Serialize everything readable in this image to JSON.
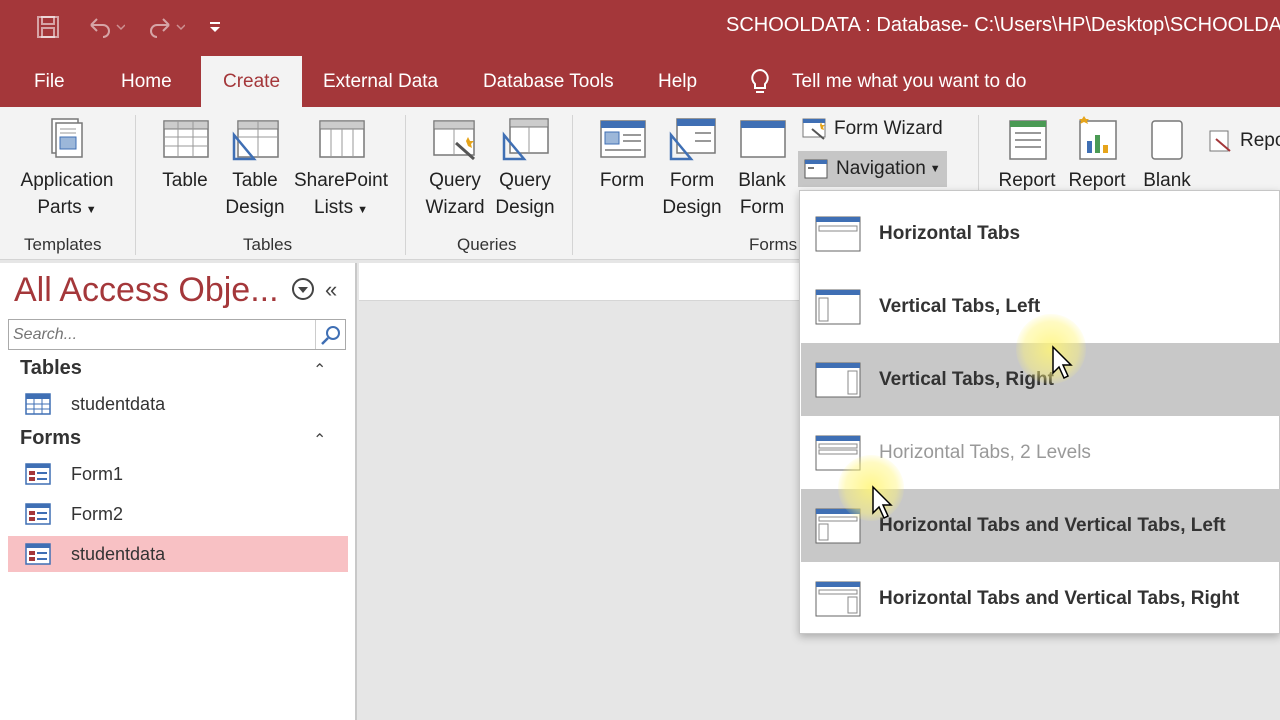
{
  "title_bar": {
    "title": "SCHOOLDATA : Database- C:\\Users\\HP\\Desktop\\SCHOOLDATA",
    "qat": [
      "save-icon",
      "undo-icon",
      "redo-icon",
      "customize-icon"
    ]
  },
  "tabs": [
    {
      "label": "File"
    },
    {
      "label": "Home"
    },
    {
      "label": "Create",
      "active": true
    },
    {
      "label": "External Data"
    },
    {
      "label": "Database Tools"
    },
    {
      "label": "Help"
    }
  ],
  "tell_me": "Tell me what you want to do",
  "ribbon": {
    "templates": {
      "app_parts": "Application",
      "app_parts_2": "Parts",
      "group": "Templates"
    },
    "tables": {
      "table": "Table",
      "table_design_1": "Table",
      "table_design_2": "Design",
      "sharepoint_1": "SharePoint",
      "sharepoint_2": "Lists",
      "group": "Tables"
    },
    "queries": {
      "wizard_1": "Query",
      "wizard_2": "Wizard",
      "design_1": "Query",
      "design_2": "Design",
      "group": "Queries"
    },
    "forms": {
      "form": "Form",
      "form_design_1": "Form",
      "form_design_2": "Design",
      "blank_1": "Blank",
      "blank_2": "Form",
      "form_wizard": "Form Wizard",
      "navigation": "Navigation",
      "group": "Forms"
    },
    "reports": {
      "report_1": "Report",
      "report_2": "Report",
      "blank": "Blank",
      "repo": "Repo"
    }
  },
  "nav_pane": {
    "title": "All Access Obje...",
    "search_placeholder": "Search...",
    "sections": [
      {
        "name": "Tables",
        "items": [
          "studentdata"
        ]
      },
      {
        "name": "Forms",
        "items": [
          "Form1",
          "Form2",
          "studentdata"
        ]
      }
    ],
    "selected_item": "studentdata"
  },
  "navigation_menu": {
    "items": [
      {
        "label": "Horizontal Tabs"
      },
      {
        "label": "Vertical Tabs, Left"
      },
      {
        "label": "Vertical Tabs, Right"
      },
      {
        "label": "Horizontal Tabs, 2 Levels"
      },
      {
        "label": "Horizontal Tabs and Vertical Tabs, Left"
      },
      {
        "label": "Horizontal Tabs and Vertical Tabs, Right"
      }
    ]
  },
  "colors": {
    "accent": "#a4373a",
    "selected": "#f8c1c4",
    "hover": "#c8c8c8"
  }
}
